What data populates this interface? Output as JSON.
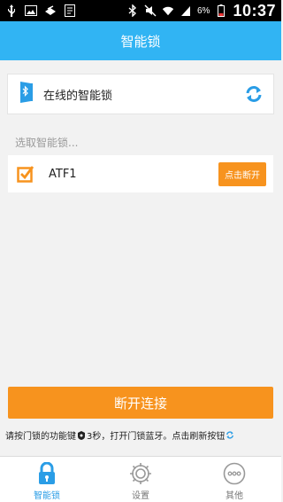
{
  "status_bar": {
    "battery_percent": "6%",
    "time": "10:37",
    "left_icons": [
      "usb-icon",
      "image-icon",
      "stack-icon",
      "document-icon"
    ],
    "right_icons": [
      "bluetooth-icon",
      "mute-icon",
      "wifi-icon",
      "signal-icon",
      "battery-icon"
    ]
  },
  "app_bar": {
    "title": "智能锁"
  },
  "online_card": {
    "label": "在线的智能锁",
    "icon": "bluetooth-door-icon",
    "refresh_icon": "refresh-icon"
  },
  "section_label": "选取智能锁...",
  "device_list": [
    {
      "name": "ATF1",
      "checked": true,
      "action_label": "点击断开"
    }
  ],
  "primary_button": {
    "label": "断开连接"
  },
  "hint": {
    "part1": "请按门锁的功能键",
    "part2": "3秒，打开门锁蓝牙。点击刷新按钮"
  },
  "tabs": [
    {
      "label": "智能锁",
      "icon": "lock-icon",
      "active": true
    },
    {
      "label": "设置",
      "icon": "settings-gear-icon",
      "active": false
    },
    {
      "label": "其他",
      "icon": "more-icon",
      "active": false
    }
  ],
  "colors": {
    "primary_blue": "#31b4f3",
    "accent_orange": "#f7931e",
    "tab_active": "#2a9de6"
  }
}
